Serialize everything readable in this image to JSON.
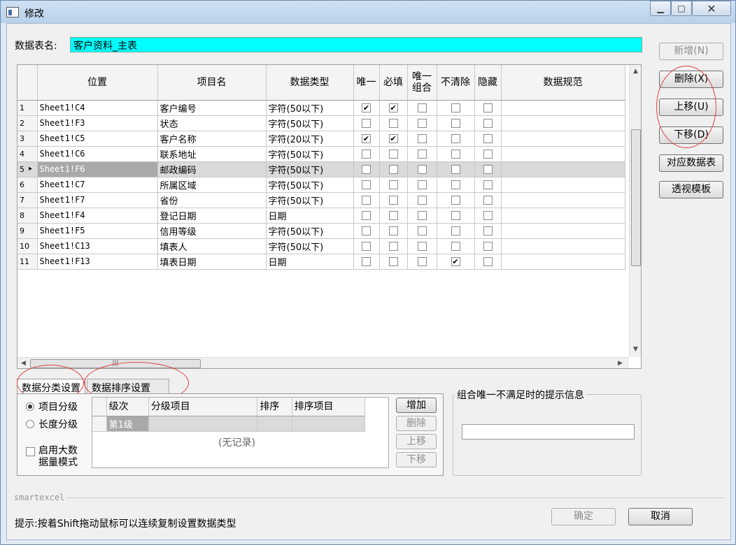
{
  "window": {
    "title": "修改",
    "minimize": "▁",
    "maximize": "□",
    "close": "✕"
  },
  "form": {
    "table_name_label": "数据表名:",
    "table_name_value": "客户资料_主表"
  },
  "grid": {
    "columns": [
      "位置",
      "项目名",
      "数据类型",
      "唯一",
      "必填",
      "唯一组合",
      "不清除",
      "隐藏",
      "数据规范"
    ],
    "rows": [
      {
        "no": "1",
        "pos": "Sheet1!C4",
        "name": "客户编号",
        "type": "字符(50以下)",
        "unique": true,
        "required": true,
        "ucombo": false,
        "noclear": false,
        "hidden": false
      },
      {
        "no": "2",
        "pos": "Sheet1!F3",
        "name": "状态",
        "type": "字符(50以下)",
        "unique": false,
        "required": false,
        "ucombo": false,
        "noclear": false,
        "hidden": false
      },
      {
        "no": "3",
        "pos": "Sheet1!C5",
        "name": "客户名称",
        "type": "字符(20以下)",
        "unique": true,
        "required": true,
        "ucombo": false,
        "noclear": false,
        "hidden": false
      },
      {
        "no": "4",
        "pos": "Sheet1!C6",
        "name": "联系地址",
        "type": "字符(50以下)",
        "unique": false,
        "required": false,
        "ucombo": false,
        "noclear": false,
        "hidden": false
      },
      {
        "no": "5",
        "pos": "Sheet1!F6",
        "name": "邮政编码",
        "type": "字符(50以下)",
        "unique": false,
        "required": false,
        "ucombo": false,
        "noclear": false,
        "hidden": false,
        "selected": true
      },
      {
        "no": "6",
        "pos": "Sheet1!C7",
        "name": "所属区域",
        "type": "字符(50以下)",
        "unique": false,
        "required": false,
        "ucombo": false,
        "noclear": false,
        "hidden": false
      },
      {
        "no": "7",
        "pos": "Sheet1!F7",
        "name": "省份",
        "type": "字符(50以下)",
        "unique": false,
        "required": false,
        "ucombo": false,
        "noclear": false,
        "hidden": false
      },
      {
        "no": "8",
        "pos": "Sheet1!F4",
        "name": "登记日期",
        "type": "日期",
        "unique": false,
        "required": false,
        "ucombo": false,
        "noclear": false,
        "hidden": false
      },
      {
        "no": "9",
        "pos": "Sheet1!F5",
        "name": "信用等级",
        "type": "字符(50以下)",
        "unique": false,
        "required": false,
        "ucombo": false,
        "noclear": false,
        "hidden": false
      },
      {
        "no": "10",
        "pos": "Sheet1!C13",
        "name": "填表人",
        "type": "字符(50以下)",
        "unique": false,
        "required": false,
        "ucombo": false,
        "noclear": false,
        "hidden": false
      },
      {
        "no": "11",
        "pos": "Sheet1!F13",
        "name": "填表日期",
        "type": "日期",
        "unique": false,
        "required": false,
        "ucombo": false,
        "noclear": true,
        "hidden": false
      }
    ]
  },
  "side_buttons": {
    "add": "新增(N)",
    "delete": "删除(X)",
    "up": "上移(U)",
    "down": "下移(D)",
    "map_table": "对应数据表",
    "pivot_template": "透视模板"
  },
  "tabs": {
    "tab1": "数据分类设置",
    "tab2": "数据排序设置"
  },
  "classify": {
    "radio_item": "项目分级",
    "radio_length": "长度分级",
    "bigdata_line1": "启用大数",
    "bigdata_line2": "据量模式",
    "sub_columns": [
      "级次",
      "分级项目",
      "排序",
      "排序项目"
    ],
    "level_row": "第1级",
    "empty_text": "(无记录)",
    "btn_add": "增加",
    "btn_delete": "删除",
    "btn_up": "上移",
    "btn_down": "下移"
  },
  "combo_msg": {
    "legend": "组合唯一不满足时的提示信息",
    "value": ""
  },
  "footer": {
    "brand": "smartexcel",
    "hint": "提示:按着Shift拖动鼠标可以连续复制设置数据类型",
    "ok": "确定",
    "cancel": "取消"
  }
}
